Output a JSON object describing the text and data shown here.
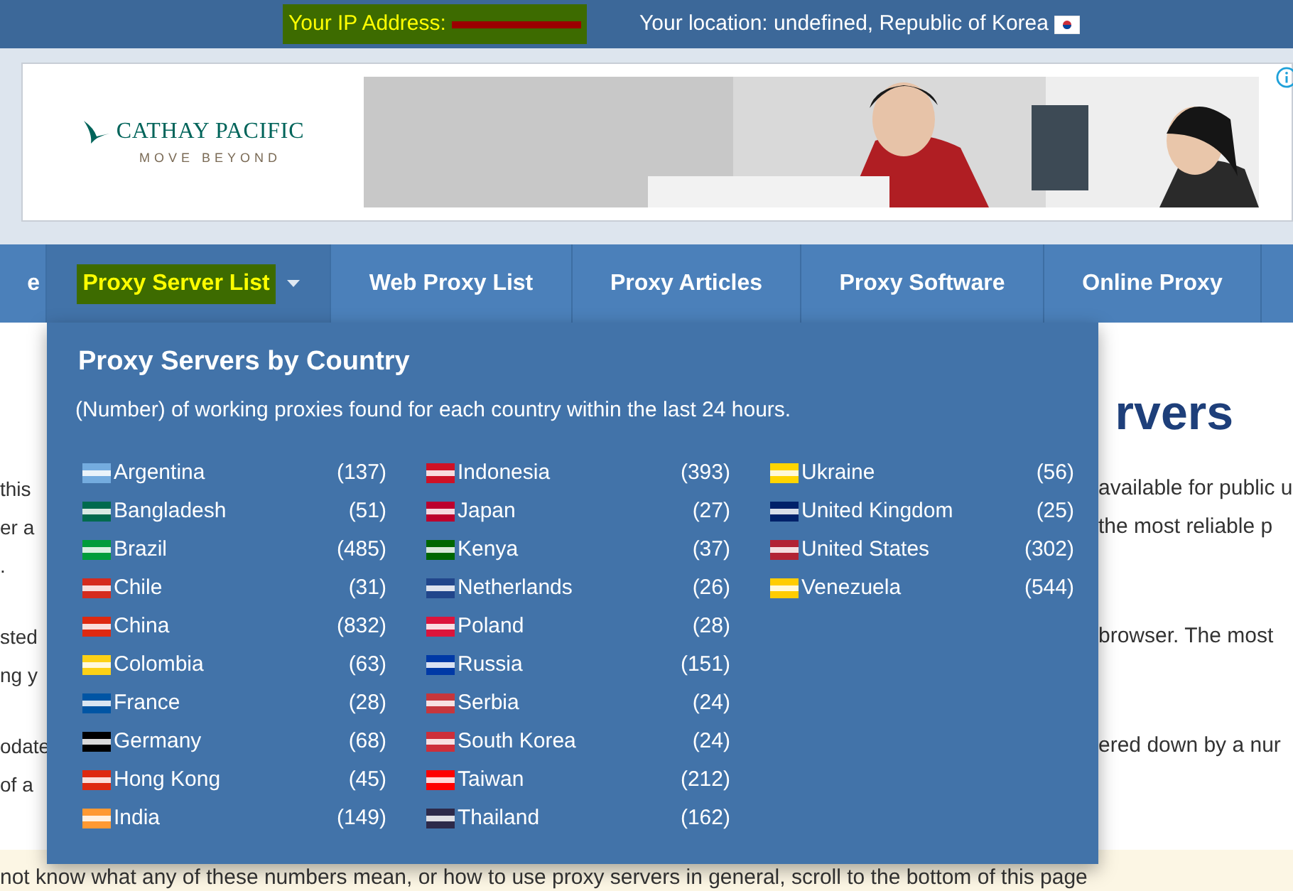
{
  "top_bar": {
    "ip_label": "Your IP Address:",
    "location": "Your location: undefined, Republic of Korea"
  },
  "nav": {
    "items": [
      {
        "label": "e",
        "selected": false,
        "dropdown": false
      },
      {
        "label": "Proxy Server List",
        "selected": true,
        "dropdown": true
      },
      {
        "label": "Web Proxy List",
        "selected": false,
        "dropdown": false
      },
      {
        "label": "Proxy Articles",
        "selected": false,
        "dropdown": false
      },
      {
        "label": "Proxy Software",
        "selected": false,
        "dropdown": false
      },
      {
        "label": "Online Proxy",
        "selected": false,
        "dropdown": false
      }
    ]
  },
  "ad": {
    "brand": "CATHAY PACIFIC",
    "tagline": "MOVE BEYOND"
  },
  "dropdown": {
    "title": "Proxy Servers by Country",
    "subtitle": "(Number) of working proxies found for each country within the last 24 hours.",
    "columns": [
      [
        {
          "name": "Argentina",
          "count": "(137)",
          "color": "#74acdf"
        },
        {
          "name": "Bangladesh",
          "count": "(51)",
          "color": "#006a4e"
        },
        {
          "name": "Brazil",
          "count": "(485)",
          "color": "#009c3b"
        },
        {
          "name": "Chile",
          "count": "(31)",
          "color": "#d52b1e"
        },
        {
          "name": "China",
          "count": "(832)",
          "color": "#de2910"
        },
        {
          "name": "Colombia",
          "count": "(63)",
          "color": "#fcd116"
        },
        {
          "name": "France",
          "count": "(28)",
          "color": "#0055a4"
        },
        {
          "name": "Germany",
          "count": "(68)",
          "color": "#000000"
        },
        {
          "name": "Hong Kong",
          "count": "(45)",
          "color": "#de2910"
        },
        {
          "name": "India",
          "count": "(149)",
          "color": "#ff9933"
        }
      ],
      [
        {
          "name": "Indonesia",
          "count": "(393)",
          "color": "#ce1126"
        },
        {
          "name": "Japan",
          "count": "(27)",
          "color": "#bc002d"
        },
        {
          "name": "Kenya",
          "count": "(37)",
          "color": "#006600"
        },
        {
          "name": "Netherlands",
          "count": "(26)",
          "color": "#21468b"
        },
        {
          "name": "Poland",
          "count": "(28)",
          "color": "#dc143c"
        },
        {
          "name": "Russia",
          "count": "(151)",
          "color": "#0039a6"
        },
        {
          "name": "Serbia",
          "count": "(24)",
          "color": "#c6363c"
        },
        {
          "name": "South Korea",
          "count": "(24)",
          "color": "#cd2e3a"
        },
        {
          "name": "Taiwan",
          "count": "(212)",
          "color": "#fe0000"
        },
        {
          "name": "Thailand",
          "count": "(162)",
          "color": "#2d2a4a"
        }
      ],
      [
        {
          "name": "Ukraine",
          "count": "(56)",
          "color": "#ffd500"
        },
        {
          "name": "United Kingdom",
          "count": "(25)",
          "color": "#012169"
        },
        {
          "name": "United States",
          "count": "(302)",
          "color": "#b22234"
        },
        {
          "name": "Venezuela",
          "count": "(544)",
          "color": "#ffcc00"
        }
      ]
    ]
  },
  "content": {
    "heading_fragment": "rvers",
    "paragraphs": [
      {
        "lines": [
          {
            "left": "this",
            "right": "available for public u"
          },
          {
            "left": "er a",
            "right": "the most reliable p"
          },
          {
            "left": "."
          }
        ]
      },
      {
        "lines": [
          {
            "left": "sted",
            "right": "browser. The most"
          },
          {
            "left": "ng y"
          }
        ]
      },
      {
        "lines": [
          {
            "left": "odate",
            "right": "ered down by a nur"
          },
          {
            "left": "of a"
          }
        ]
      }
    ],
    "notice": "not know what any of these numbers mean, or how to use proxy servers in general, scroll to the bottom of this page"
  }
}
